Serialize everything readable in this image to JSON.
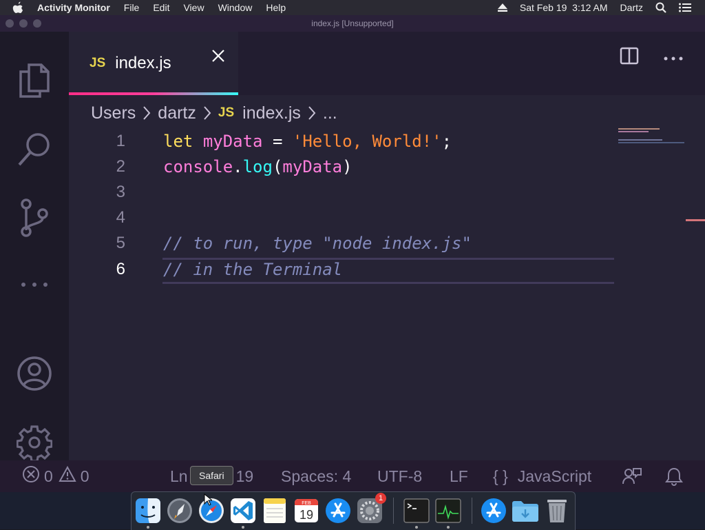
{
  "menubar": {
    "app_name": "Activity Monitor",
    "menus": [
      "File",
      "Edit",
      "View",
      "Window",
      "Help"
    ],
    "datetime": "Sat Feb 19  3:12 AM",
    "user": "Dartz"
  },
  "window": {
    "title": "index.js [Unsupported]"
  },
  "editor": {
    "tab": {
      "badge": "JS",
      "label": "index.js"
    },
    "breadcrumb": {
      "part1": "Users",
      "part2": "dartz",
      "badge": "JS",
      "file": "index.js",
      "more": "..."
    },
    "lines": [
      {
        "num": "1"
      },
      {
        "num": "2"
      },
      {
        "num": "3"
      },
      {
        "num": "4"
      },
      {
        "num": "5"
      },
      {
        "num": "6"
      }
    ],
    "code": {
      "l1_kw": "let",
      "l1_var": "myData",
      "l1_op": "=",
      "l1_str": "'Hello, World!'",
      "l1_end": ";",
      "l2_obj": "console",
      "l2_dot": ".",
      "l2_fn": "log",
      "l2_open": "(",
      "l2_arg": "myData",
      "l2_close": ")",
      "l5_comment": "// to run, type \"node index.js\"",
      "l6_comment": "// in the Terminal"
    },
    "active_line": "6"
  },
  "statusbar": {
    "errors": "0",
    "warnings": "0",
    "position_prefix": "Ln",
    "position_suffix": "19",
    "spaces": "Spaces: 4",
    "encoding": "UTF-8",
    "eol": "LF",
    "braces": "{ }",
    "language": "JavaScript"
  },
  "tooltip": {
    "text": "Safari"
  },
  "dock": {
    "items": [
      "Finder",
      "Launchpad",
      "Safari",
      "Visual Studio Code",
      "Notes",
      "Calendar",
      "App Store",
      "System Preferences",
      "Terminal",
      "Activity Monitor",
      "App Store",
      "Downloads",
      "Trash"
    ],
    "calendar_month": "FEB",
    "calendar_day": "19",
    "sysprefs_badge": "1"
  },
  "colors": {
    "accent_pink": "#ff2e88",
    "accent_cyan": "#36f9f6",
    "editor_bg": "#262335"
  }
}
